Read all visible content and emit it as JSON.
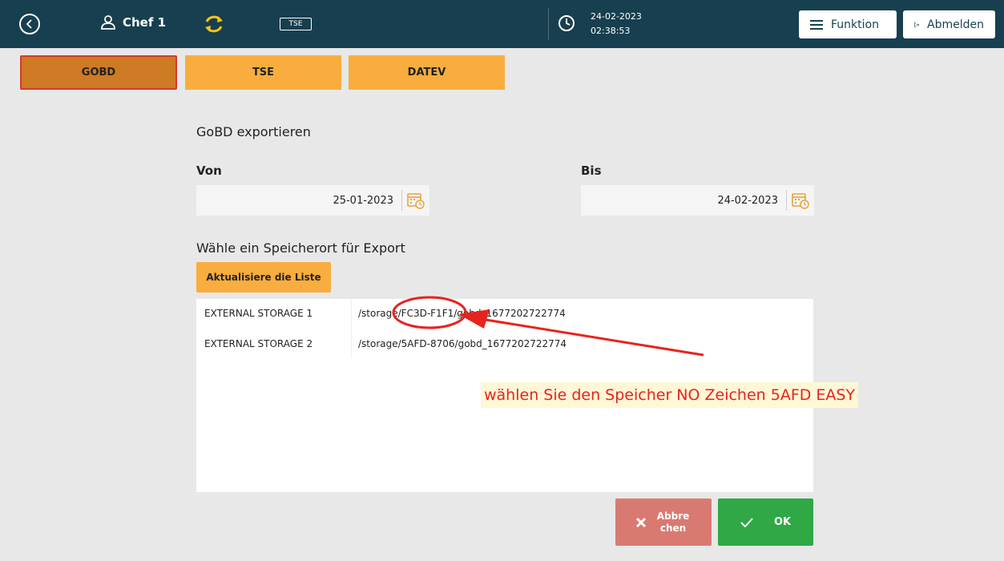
{
  "topbar": {
    "user_name": "Chef 1",
    "tse_label": "TSE",
    "date": "24-02-2023",
    "time": "02:38:53",
    "funktion_label": "Funktion",
    "abmelden_label": "Abmelden",
    "icons": [
      "back-icon",
      "user-icon",
      "sync-icon",
      "tse-icon",
      "clock-icon",
      "menu-icon",
      "logout-icon"
    ]
  },
  "tabs": [
    {
      "label": "GOBD",
      "active": true
    },
    {
      "label": "TSE",
      "active": false
    },
    {
      "label": "DATEV",
      "active": false
    }
  ],
  "export": {
    "title": "GoBD exportieren",
    "von_label": "Von",
    "von_value": "25-01-2023",
    "bis_label": "Bis",
    "bis_value": "24-02-2023",
    "storage_title": "Wähle ein Speicherort für Export",
    "refresh_label": "Aktualisiere die Liste"
  },
  "storages": [
    {
      "name": "EXTERNAL STORAGE 1",
      "path": "/storage/FC3D-F1F1/gobd_1677202722774"
    },
    {
      "name": "EXTERNAL STORAGE 2",
      "path": "/storage/5AFD-8706/gobd_1677202722774"
    }
  ],
  "annotation": {
    "text": "wählen Sie den Speicher NO Zeichen 5AFD EASY",
    "color": "#e8231e"
  },
  "actions": {
    "cancel_label": "Abbrechen",
    "ok_label": "OK"
  },
  "colors": {
    "topbar": "#173f4f",
    "tab": "#f9ad3e",
    "tab_active": "#cf7a24",
    "cancel": "#d97a72",
    "ok": "#2fa845",
    "sync": "#f5c518"
  }
}
